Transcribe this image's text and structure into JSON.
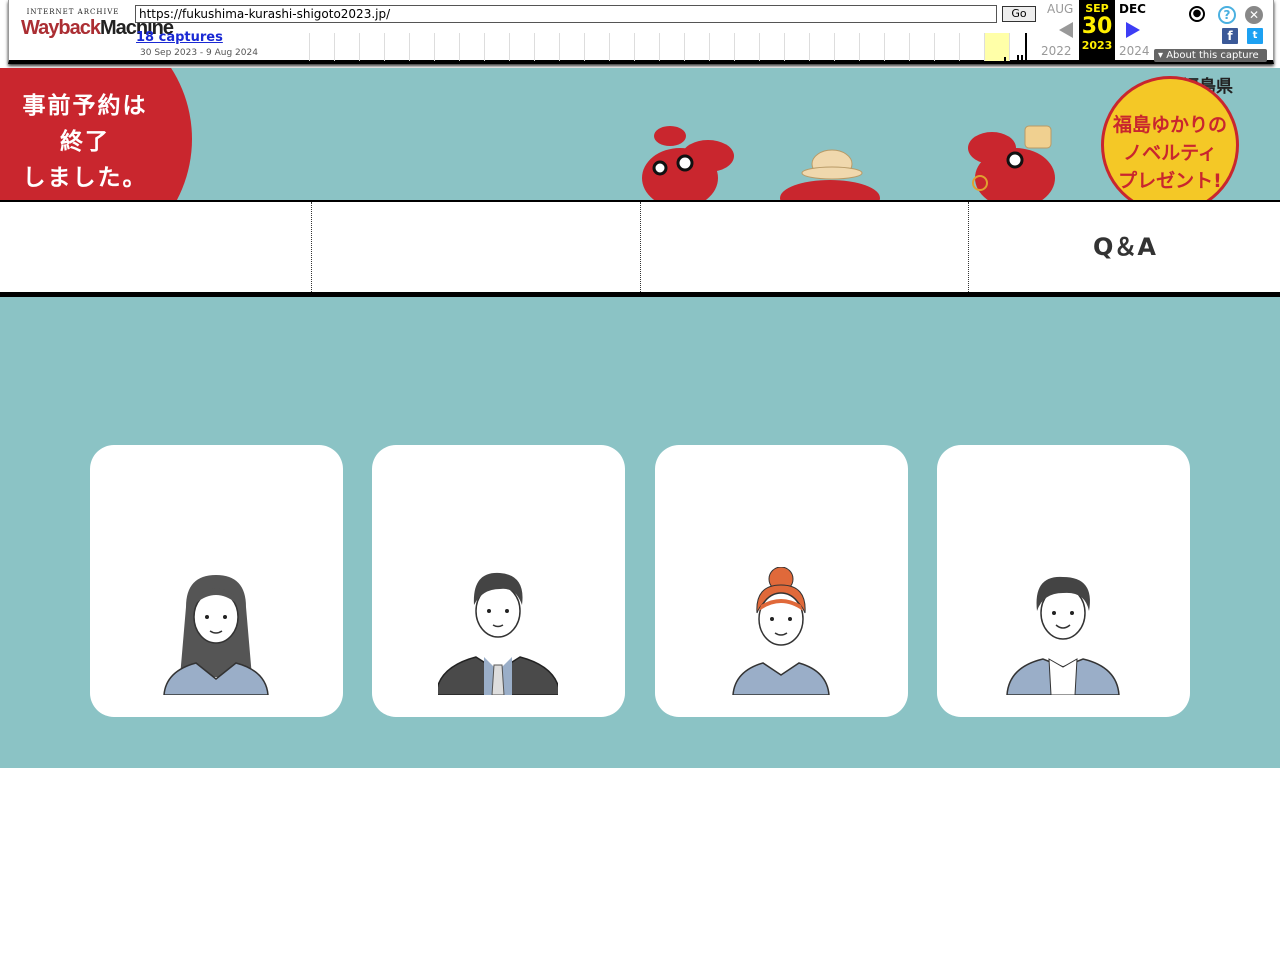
{
  "wayback": {
    "logo_top": "INTERNET ARCHIVE",
    "logo_bottom_w": "Wayback",
    "logo_bottom_m": "Machine",
    "url": "https://fukushima-kurashi-shigoto2023.jp/",
    "go_label": "Go",
    "captures": "18 captures",
    "range": "30 Sep 2023 - 9 Aug 2024",
    "prev_month": "AUG",
    "prev_year": "2022",
    "cur_month": "SEP",
    "cur_day": "30",
    "cur_year": "2023",
    "next_month": "DEC",
    "next_year": "2024",
    "about": "About this capture",
    "icons": [
      "user-icon",
      "help-icon",
      "close-icon",
      "facebook-icon",
      "twitter-icon"
    ]
  },
  "hero": {
    "badge_line1": "事前予約は",
    "badge_line2": "終了",
    "badge_line3": "しました。",
    "logo": "福島県",
    "novelty_line1": "福島ゆかりの",
    "novelty_line2": "ノベルティ",
    "novelty_line3": "プレゼント!"
  },
  "nav": {
    "items": [
      {
        "label": "",
        "line2": ""
      },
      {
        "label": "",
        "line2": ""
      },
      {
        "label": "",
        "line2": ""
      },
      {
        "label": "Q＆A",
        "line2": ""
      }
    ]
  },
  "main": {
    "title": "",
    "cards": [
      {
        "line1": "",
        "line2": "",
        "line3": ""
      },
      {
        "line1": "",
        "line2": "",
        "line3": ""
      },
      {
        "line1": "",
        "line2": "",
        "line3": ""
      },
      {
        "line1": "",
        "line2": "",
        "line3": ""
      }
    ]
  },
  "colors": {
    "teal": "#8bc3c5",
    "red": "#c9262e",
    "yellow": "#f4c826",
    "avatar_blue": "#9aaec8",
    "hair_orange": "#e0693a"
  }
}
